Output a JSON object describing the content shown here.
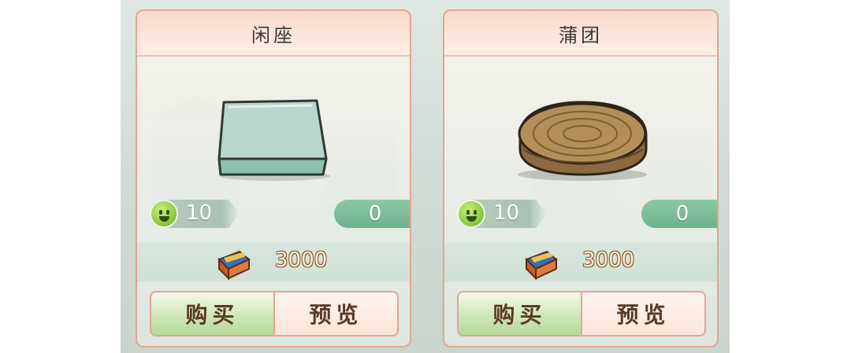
{
  "shop_items": [
    {
      "name": "闲座",
      "icon": "stone-seat-icon",
      "heat": "10",
      "owned": "0",
      "price": "3000",
      "buy_label": "购买",
      "preview_label": "预览"
    },
    {
      "name": "蒲团",
      "icon": "straw-cushion-icon",
      "heat": "10",
      "owned": "0",
      "price": "3000",
      "buy_label": "购买",
      "preview_label": "预览"
    }
  ],
  "colors": {
    "card_border": "#e2a592",
    "header_bg": "#fbd9cd",
    "owned_pill": "#6fb28e",
    "buy_button": "#b4d99b",
    "preview_button": "#fbe5d8"
  }
}
